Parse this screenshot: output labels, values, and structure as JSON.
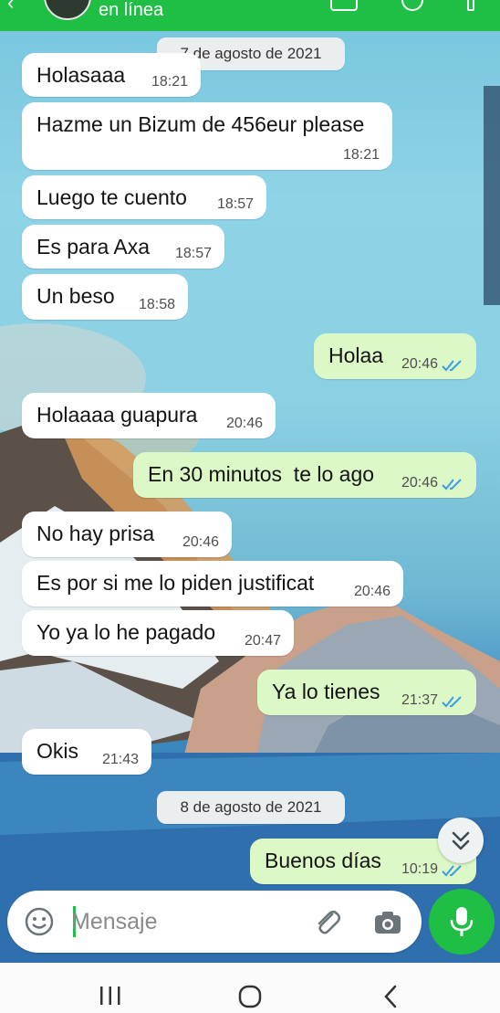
{
  "header": {
    "status": "en línea"
  },
  "date_chips": [
    "7 de agosto de 2021",
    "8 de agosto de 2021"
  ],
  "messages": [
    {
      "dir": "in",
      "text": "Holasaaa",
      "time": "18:21"
    },
    {
      "dir": "in",
      "text": "Hazme un Bizum de 456eur please",
      "time": "18:21"
    },
    {
      "dir": "in",
      "text": "Luego te cuento",
      "time": "18:57"
    },
    {
      "dir": "in",
      "text": "Es para Axa",
      "time": "18:57"
    },
    {
      "dir": "in",
      "text": "Un beso",
      "time": "18:58"
    },
    {
      "dir": "out",
      "text": "Holaa",
      "time": "20:46"
    },
    {
      "dir": "in",
      "text": "Holaaaa guapura",
      "time": "20:46"
    },
    {
      "dir": "out",
      "text": "En 30 minutos  te lo ago",
      "time": "20:46"
    },
    {
      "dir": "in",
      "text": "No hay prisa",
      "time": "20:46"
    },
    {
      "dir": "in",
      "text": "Es por si me lo piden justificat",
      "time": "20:46"
    },
    {
      "dir": "in",
      "text": "Yo ya lo he pagado",
      "time": "20:47"
    },
    {
      "dir": "out",
      "text": "Ya lo tienes",
      "time": "21:37"
    },
    {
      "dir": "in",
      "text": "Okis",
      "time": "21:43"
    },
    {
      "dir": "out",
      "text": "Buenos días",
      "time": "10:19"
    }
  ],
  "input": {
    "placeholder": "Mensaje"
  },
  "colors": {
    "accent": "#1fbf45",
    "outgoing_bubble": "#dcf8c6",
    "incoming_bubble": "#ffffff",
    "read_ticks": "#3a9de8"
  }
}
